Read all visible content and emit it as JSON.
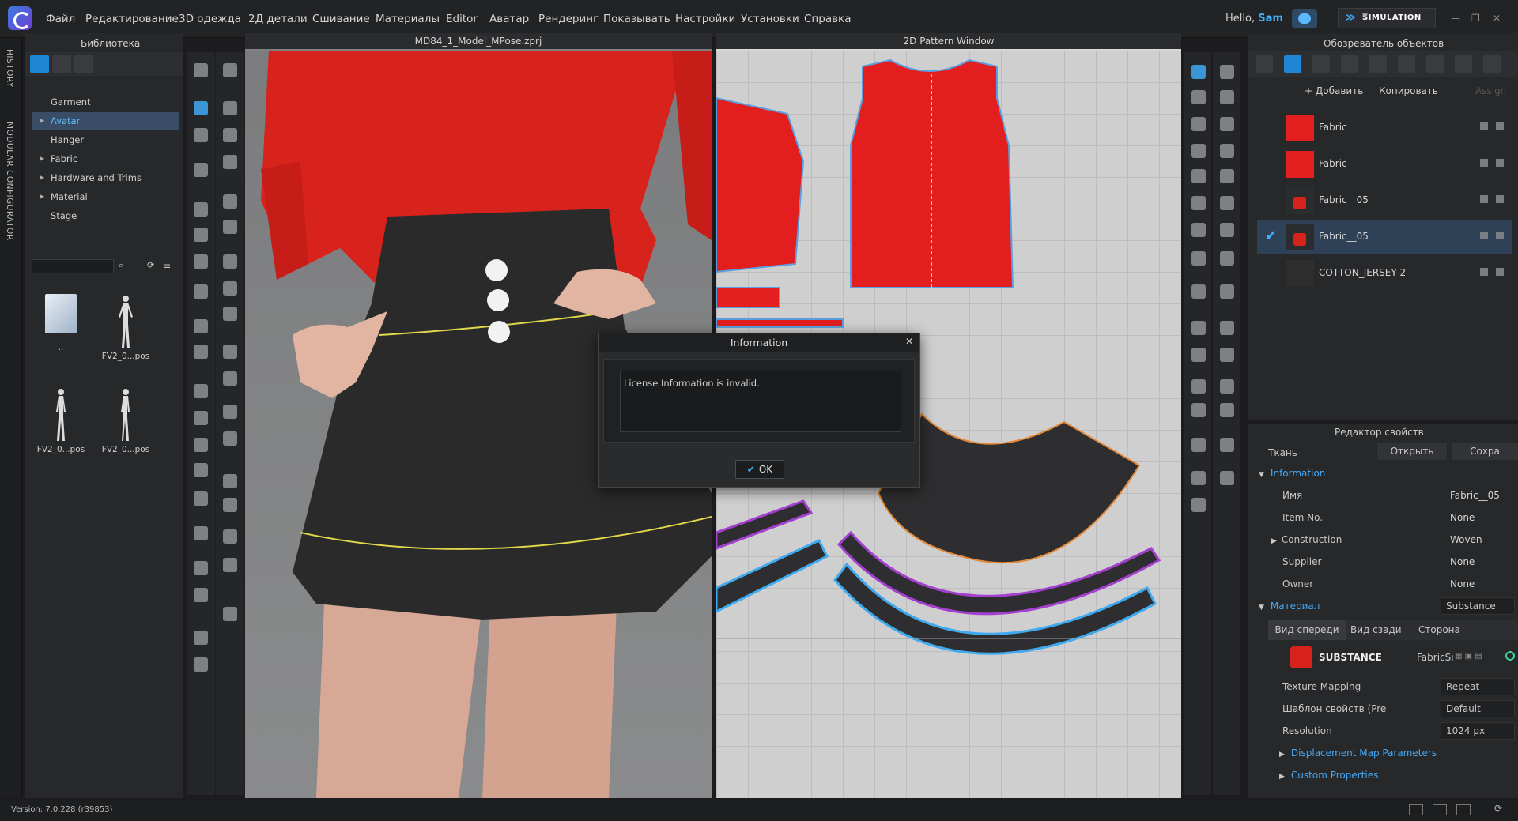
{
  "menubar": {
    "items": [
      "Файл",
      "Редактирование",
      "3D одежда",
      "2Д детали",
      "Сшивание",
      "Материалы",
      "Editor",
      "Аватар",
      "Рендеринг",
      "Показывать",
      "Настройки",
      "Установки",
      "Справка"
    ],
    "hello": "Hello, ",
    "user": "Sam",
    "mode": "SIMULATION"
  },
  "left_tabs": {
    "history": "HISTORY",
    "modular": "MODULAR CONFIGURATOR"
  },
  "library": {
    "title": "Библиотека",
    "tree": [
      "Garment",
      "Avatar",
      "Hanger",
      "Fabric",
      "Hardware and Trims",
      "Material",
      "Stage"
    ],
    "selected": "Avatar",
    "thumbs": [
      "..",
      "FV2_0...pos",
      "FV2_0...pos",
      "FV2_0...pos"
    ]
  },
  "viewport3d": {
    "title": "MD84_1_Model_MPose.zprj"
  },
  "viewport2d": {
    "title": "2D Pattern Window"
  },
  "object_browser": {
    "title": "Обозреватель объектов",
    "add_label": "+ Добавить",
    "copy_label": "Копировать",
    "assign_label": "Assign",
    "fabrics": [
      {
        "name": "Fabric",
        "color": "#e31e1e"
      },
      {
        "name": "Fabric",
        "color": "#e31e1e"
      },
      {
        "name": "Fabric__05",
        "color": "substance"
      },
      {
        "name": "Fabric__05",
        "color": "substance"
      },
      {
        "name": "COTTON_JERSEY 2",
        "color": "#2d2d2d"
      }
    ],
    "selected_index": 3
  },
  "property_editor": {
    "title": "Редактор свойств",
    "category": "Ткань",
    "open_label": "Открыть",
    "save_label": "Сохра",
    "information": "Information",
    "rows": [
      {
        "label": "Имя",
        "value": "Fabric__05"
      },
      {
        "label": "Item No.",
        "value": "None"
      },
      {
        "label": "Construction",
        "value": "Woven"
      },
      {
        "label": "Supplier",
        "value": "None"
      },
      {
        "label": "Owner",
        "value": "None"
      }
    ],
    "material": "Материал",
    "material_value": "Substance",
    "tabs": [
      "Вид спереди",
      "Вид сзади",
      "Сторона"
    ],
    "substance_label": "SUBSTANCE",
    "substance_file": "FabricSı",
    "texture_mapping_label": "Texture Mapping",
    "texture_mapping_value": "Repeat",
    "preset_label": "Шаблон свойств (Pre",
    "preset_value": "Default",
    "resolution_label": "Resolution",
    "resolution_value": "1024 px",
    "displacement": "Displacement Map Parameters",
    "custom": "Custom Properties"
  },
  "dialog": {
    "title": "Information",
    "message": "License Information is invalid.",
    "ok_label": "OK"
  },
  "status": {
    "version": "Version: 7.0.228 (r39853)"
  }
}
